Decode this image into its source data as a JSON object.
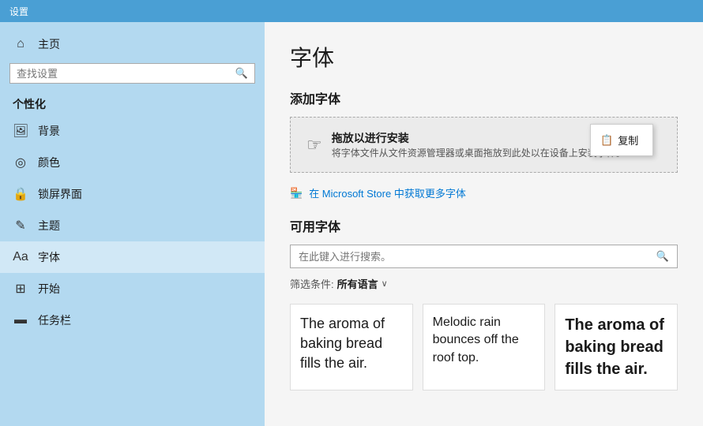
{
  "topbar": {
    "title": "设置"
  },
  "sidebar": {
    "search_placeholder": "查找设置",
    "section_label": "个性化",
    "items": [
      {
        "id": "home",
        "icon": "⌂",
        "label": "主页"
      },
      {
        "id": "background",
        "icon": "🖼",
        "label": "背景"
      },
      {
        "id": "color",
        "icon": "☯",
        "label": "颜色"
      },
      {
        "id": "lockscreen",
        "icon": "🔒",
        "label": "锁屏界面"
      },
      {
        "id": "theme",
        "icon": "🖋",
        "label": "主题"
      },
      {
        "id": "font",
        "icon": "Aa",
        "label": "字体"
      },
      {
        "id": "start",
        "icon": "⊞",
        "label": "开始"
      },
      {
        "id": "taskbar",
        "icon": "▬",
        "label": "任务栏"
      }
    ]
  },
  "content": {
    "page_title": "字体",
    "add_font_section": "添加字体",
    "drop_zone": {
      "icon": "👆",
      "main_text": "拖放以进行安装",
      "sub_text": "将字体文件从文件资源管理器或桌面拖放到此处以在设备上安装字体。"
    },
    "context_menu": {
      "item": "复制"
    },
    "store_link": "在 Microsoft Store 中获取更多字体",
    "available_fonts_section": "可用字体",
    "search_placeholder": "在此键入进行搜索。",
    "filter": {
      "label": "筛选条件:",
      "value": "所有语言",
      "chevron": "∨"
    },
    "font_previews": [
      {
        "text": "The aroma of baking bread fills the air.",
        "style": "normal"
      },
      {
        "text": "Melodic rain bounces off the roof top.",
        "style": "normal"
      },
      {
        "text": "The aroma of baking bread fills the air.",
        "style": "bold"
      }
    ]
  }
}
